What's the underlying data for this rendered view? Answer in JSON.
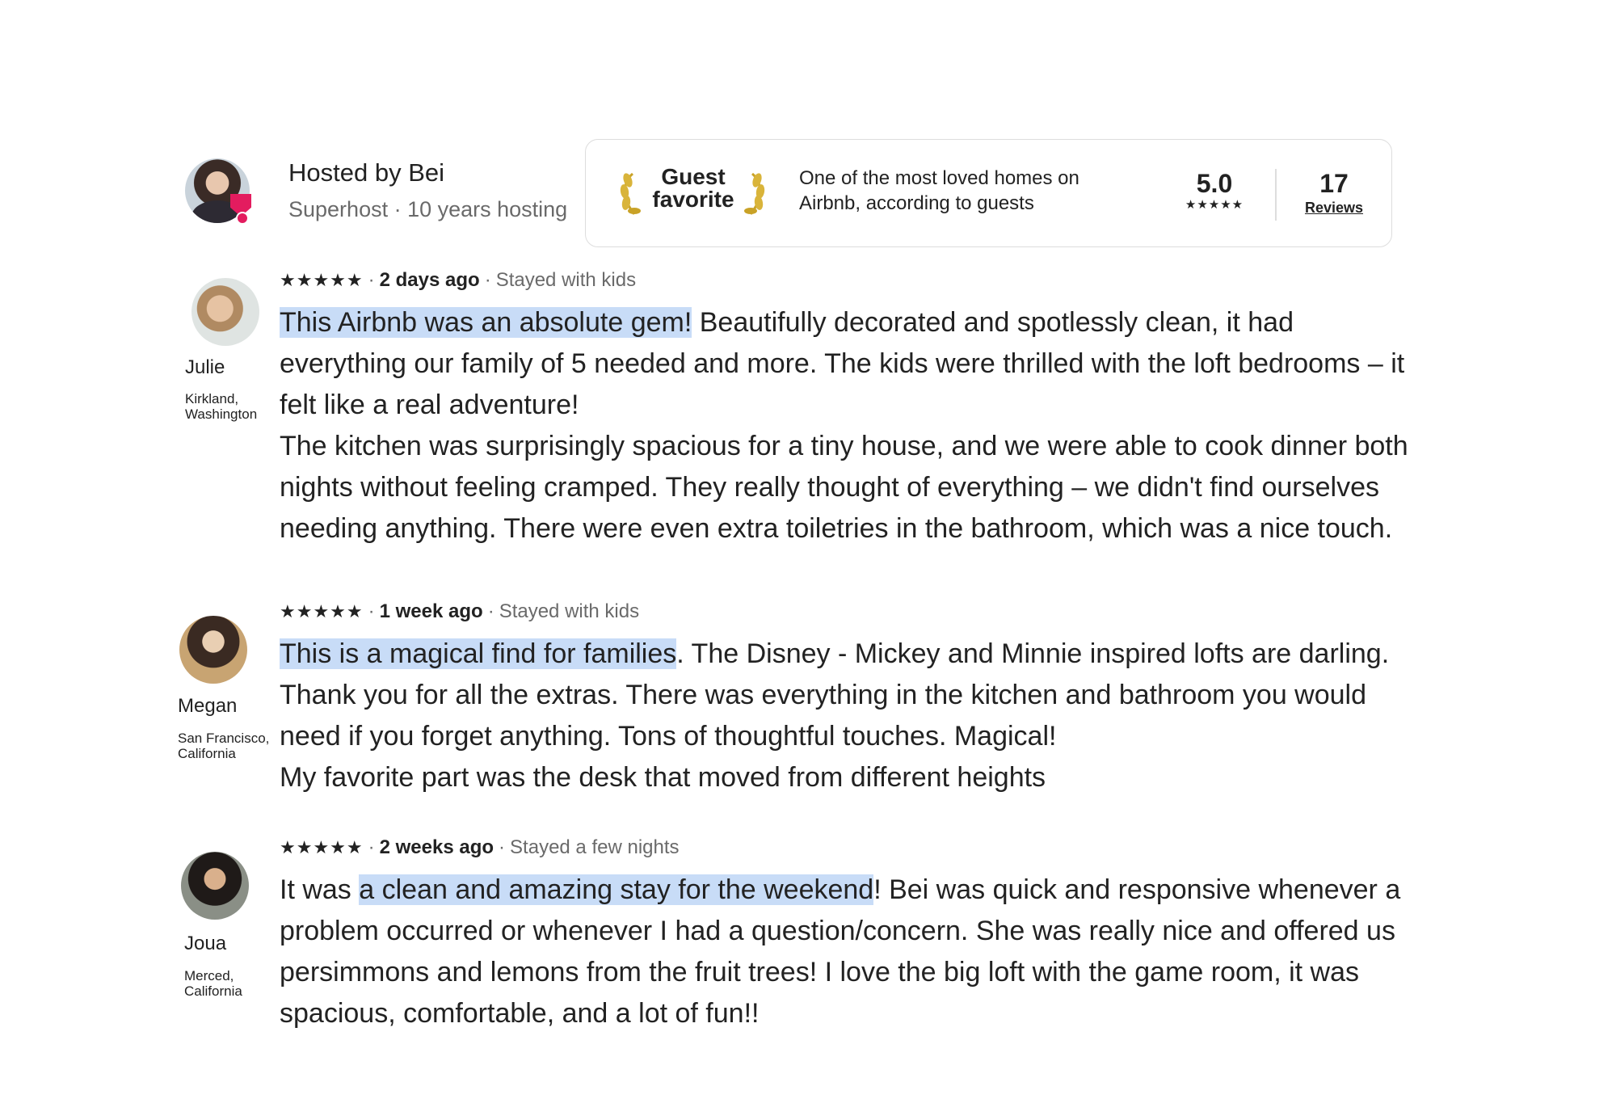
{
  "host": {
    "name": "Hosted by Bei",
    "subtitle": "Superhost · 10 years hosting"
  },
  "guest_favorite": {
    "label_line1": "Guest",
    "label_line2": "favorite",
    "description": "One of the most loved homes on Airbnb, according to guests",
    "rating": "5.0",
    "rating_stars": "★★★★★",
    "review_count": "17",
    "reviews_link": "Reviews"
  },
  "reviews": [
    {
      "name": "Julie",
      "location": "Kirkland, Washington",
      "stars": "★★★★★",
      "when": "2 days ago",
      "trip": "Stayed with kids",
      "highlight": "This Airbnb was an absolute gem!",
      "text": " Beautifully decorated and spotlessly clean, it had everything our family of 5 needed and more. The kids were thrilled with the loft bedrooms – it felt like a real adventure!",
      "text2": "The kitchen was surprisingly spacious for a tiny house, and we were able to cook dinner both nights without feeling cramped. They really thought of everything – we didn't find ourselves needing anything. There were even extra toiletries in the bathroom, which was a nice touch."
    },
    {
      "name": "Megan",
      "location": "San Francisco, California",
      "stars": "★★★★★",
      "when": "1 week ago",
      "trip": "Stayed with kids",
      "highlight": "This is a magical find for families",
      "text": ". The Disney - Mickey and Minnie inspired lofts are darling. Thank you for all the extras. There was everything in the kitchen and bathroom you would need if you forget anything. Tons of thoughtful touches. Magical!",
      "text2": "My favorite part was the desk that moved from different heights"
    },
    {
      "name": "Joua",
      "location": "Merced, California",
      "stars": "★★★★★",
      "when": "2 weeks ago",
      "trip": "Stayed a few nights",
      "prefix": "It was ",
      "highlight": "a clean and amazing stay for the weekend",
      "text": "! Bei was quick and responsive whenever a problem occurred or whenever I had a question/concern. She was really nice and offered us persimmons and lemons from the fruit trees! I love the big loft with the game room, it was spacious, comfortable, and a lot of fun!!"
    }
  ],
  "colors": {
    "highlight": "#c8dcf7",
    "superhost_badge": "#e31c5f",
    "muted_text": "#6a6a6a",
    "laurel_gold": "#c9a227"
  }
}
